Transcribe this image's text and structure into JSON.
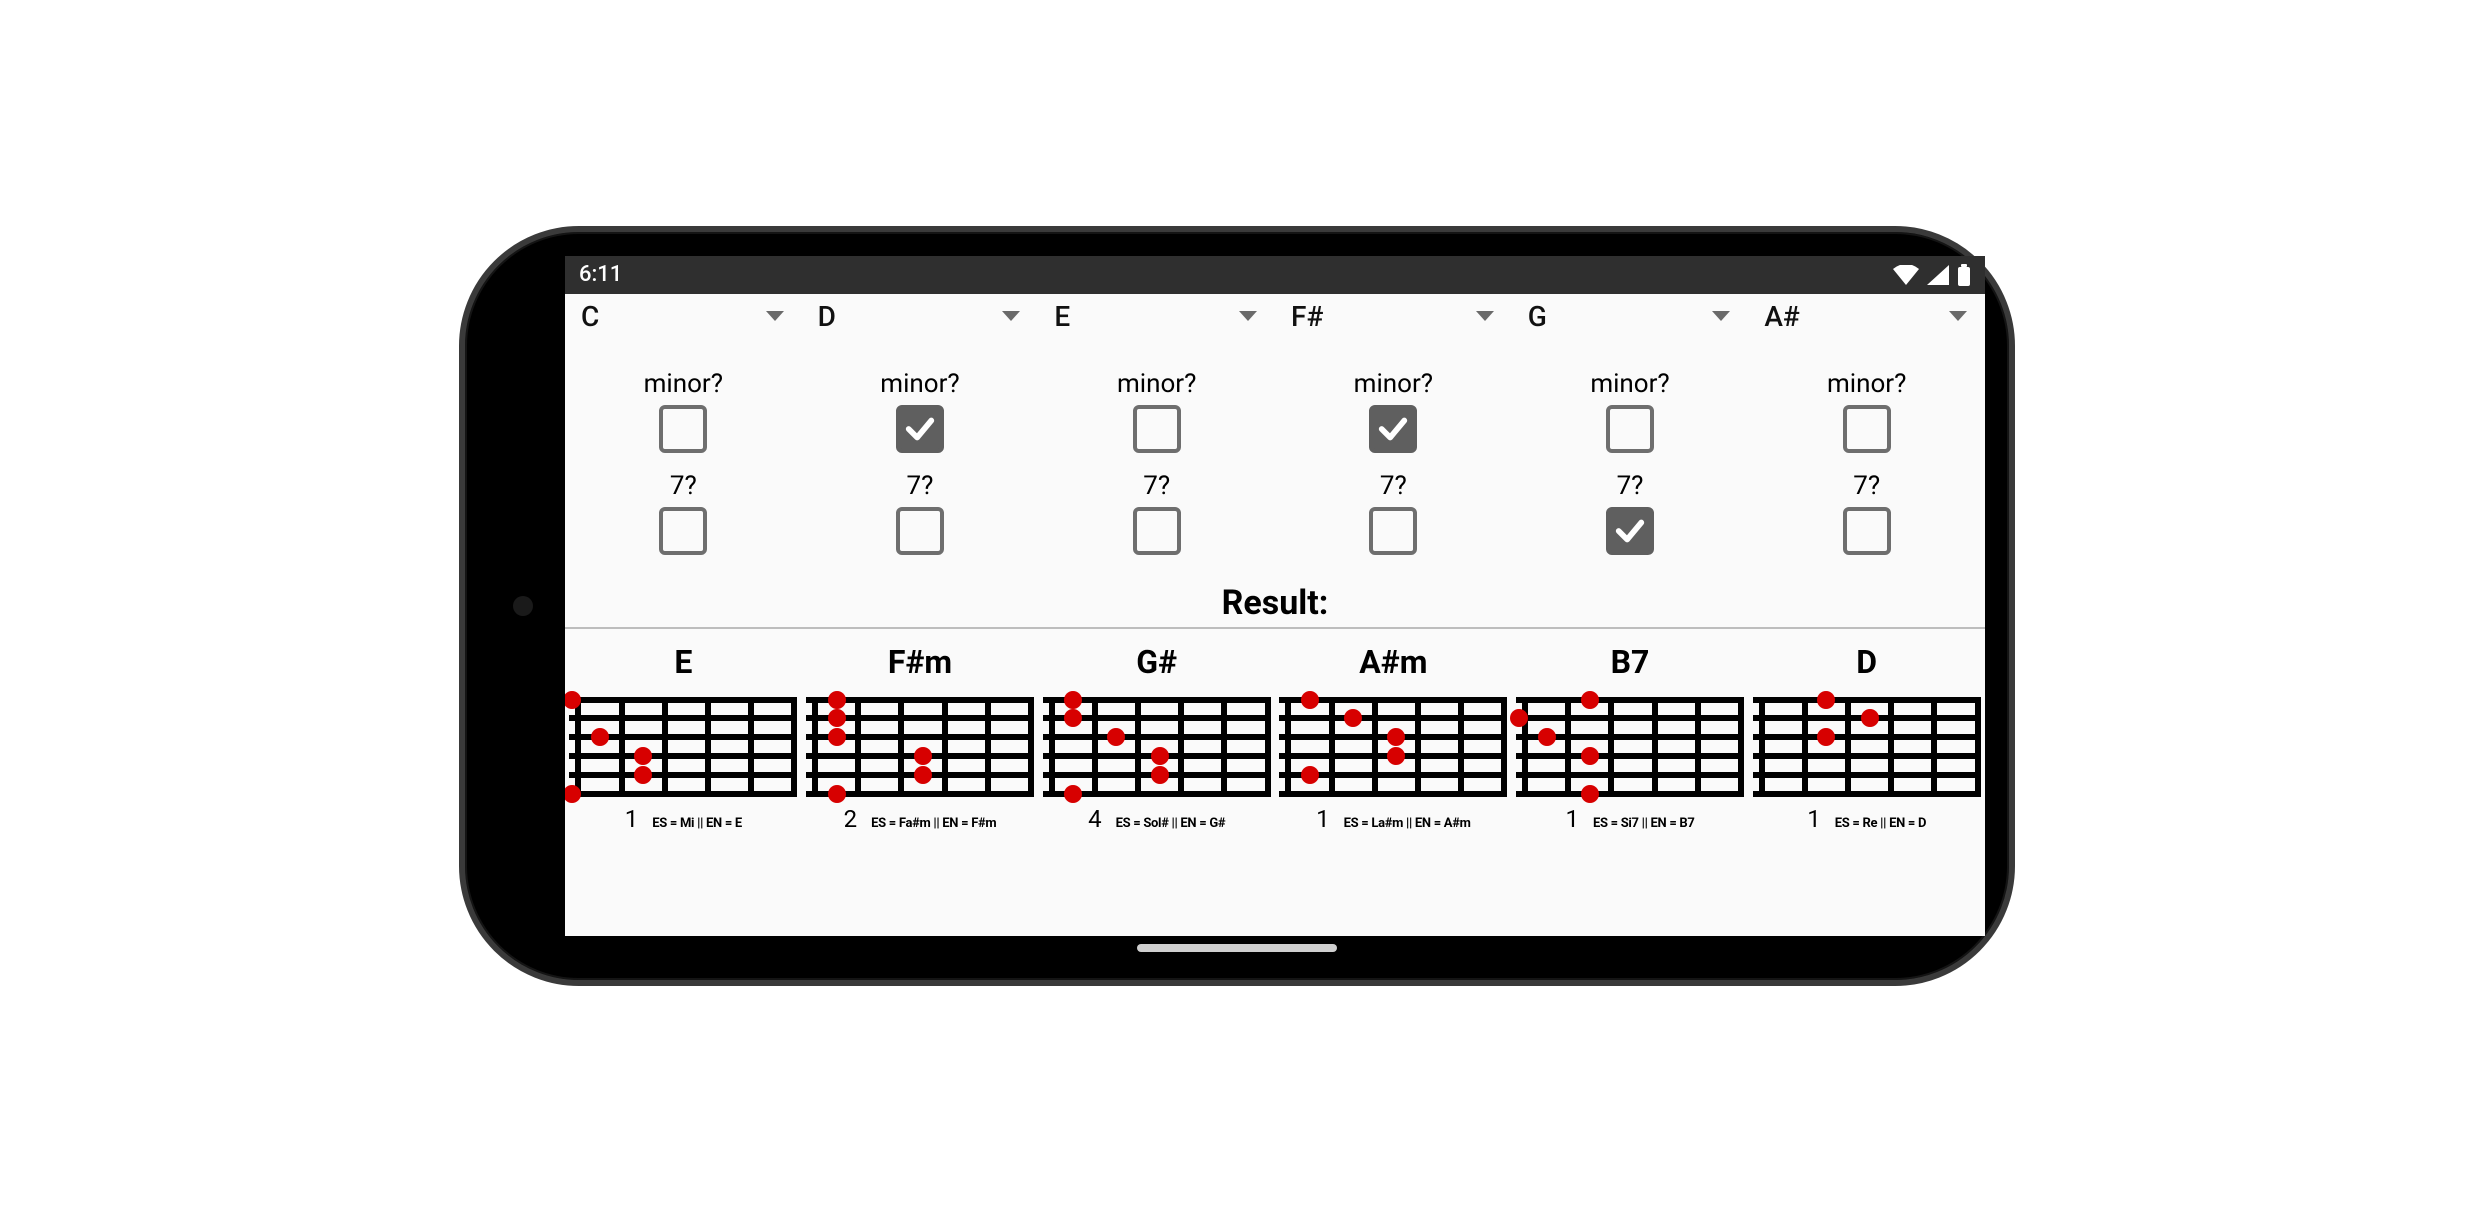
{
  "status_bar": {
    "time": "6:11"
  },
  "selectors": [
    {
      "note": "C"
    },
    {
      "note": "D"
    },
    {
      "note": "E"
    },
    {
      "note": "F#"
    },
    {
      "note": "G"
    },
    {
      "note": "A#"
    }
  ],
  "minor_label": "minor?",
  "minor": [
    false,
    true,
    false,
    true,
    false,
    false
  ],
  "seventh_label": "7?",
  "seventh": [
    false,
    false,
    false,
    false,
    true,
    false
  ],
  "result_label": "Result:",
  "results": [
    {
      "name": "E",
      "position": "1",
      "subtitle": "ES = Mi  ||  EN = E",
      "fingers": [
        {
          "fret": 0,
          "string": 0
        },
        {
          "fret": 1,
          "string": 2
        },
        {
          "fret": 2,
          "string": 3
        },
        {
          "fret": 2,
          "string": 4
        },
        {
          "fret": 0,
          "string": 5
        }
      ]
    },
    {
      "name": "F#m",
      "position": "2",
      "subtitle": "ES = Fa#m  ||  EN = F#m",
      "fingers": [
        {
          "fret": 1,
          "string": 0
        },
        {
          "fret": 1,
          "string": 1
        },
        {
          "fret": 1,
          "string": 2
        },
        {
          "fret": 3,
          "string": 3
        },
        {
          "fret": 3,
          "string": 4
        },
        {
          "fret": 1,
          "string": 5
        }
      ]
    },
    {
      "name": "G#",
      "position": "4",
      "subtitle": "ES = Sol#  ||  EN = G#",
      "fingers": [
        {
          "fret": 1,
          "string": 0
        },
        {
          "fret": 1,
          "string": 1
        },
        {
          "fret": 2,
          "string": 2
        },
        {
          "fret": 3,
          "string": 3
        },
        {
          "fret": 3,
          "string": 4
        },
        {
          "fret": 1,
          "string": 5
        }
      ]
    },
    {
      "name": "A#m",
      "position": "1",
      "subtitle": "ES = La#m  ||  EN = A#m",
      "fingers": [
        {
          "fret": 1,
          "string": 0
        },
        {
          "fret": 2,
          "string": 1
        },
        {
          "fret": 3,
          "string": 2
        },
        {
          "fret": 3,
          "string": 3
        },
        {
          "fret": 1,
          "string": 4
        }
      ]
    },
    {
      "name": "B7",
      "position": "1",
      "subtitle": "ES = Si7  ||  EN = B7",
      "fingers": [
        {
          "fret": 0,
          "string": 1
        },
        {
          "fret": 2,
          "string": 0
        },
        {
          "fret": 1,
          "string": 2
        },
        {
          "fret": 2,
          "string": 3
        },
        {
          "fret": 2,
          "string": 5
        }
      ]
    },
    {
      "name": "D",
      "position": "1",
      "subtitle": "ES = Re  ||  EN = D",
      "fingers": [
        {
          "fret": 2,
          "string": 0
        },
        {
          "fret": 3,
          "string": 1
        },
        {
          "fret": 2,
          "string": 2
        }
      ]
    }
  ]
}
